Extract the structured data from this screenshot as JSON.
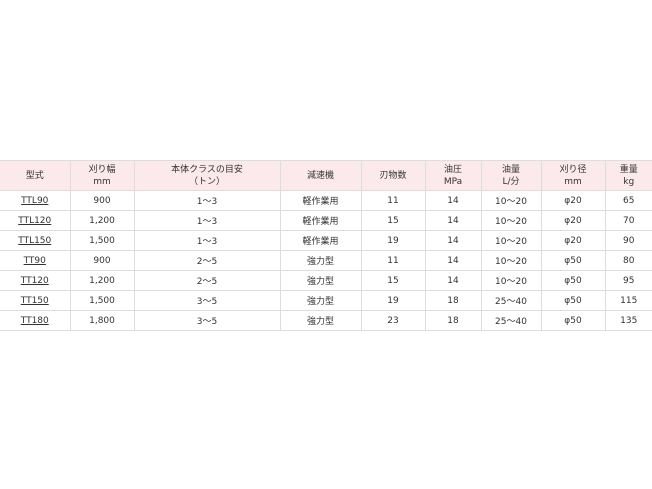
{
  "table": {
    "headers": [
      {
        "line1": "型式",
        "line2": ""
      },
      {
        "line1": "刈り幅",
        "line2": "mm"
      },
      {
        "line1": "本体クラスの目安",
        "line2": "（トン）"
      },
      {
        "line1": "減速機",
        "line2": ""
      },
      {
        "line1": "刃物数",
        "line2": ""
      },
      {
        "line1": "油圧",
        "line2": "MPa"
      },
      {
        "line1": "油量",
        "line2": "L/分"
      },
      {
        "line1": "刈り径",
        "line2": "mm"
      },
      {
        "line1": "重量",
        "line2": "kg"
      }
    ],
    "rows": [
      {
        "model": "TTL90",
        "width": "900",
        "class": "1〜3",
        "reducer": "軽作業用",
        "blades": "11",
        "pressure": "14",
        "flow": "10〜20",
        "diameter": "φ20",
        "weight": "65"
      },
      {
        "model": "TTL120",
        "width": "1,200",
        "class": "1〜3",
        "reducer": "軽作業用",
        "blades": "15",
        "pressure": "14",
        "flow": "10〜20",
        "diameter": "φ20",
        "weight": "70"
      },
      {
        "model": "TTL150",
        "width": "1,500",
        "class": "1〜3",
        "reducer": "軽作業用",
        "blades": "19",
        "pressure": "14",
        "flow": "10〜20",
        "diameter": "φ20",
        "weight": "90"
      },
      {
        "model": "TT90",
        "width": "900",
        "class": "2〜5",
        "reducer": "強力型",
        "blades": "11",
        "pressure": "14",
        "flow": "10〜20",
        "diameter": "φ50",
        "weight": "80"
      },
      {
        "model": "TT120",
        "width": "1,200",
        "class": "2〜5",
        "reducer": "強力型",
        "blades": "15",
        "pressure": "14",
        "flow": "10〜20",
        "diameter": "φ50",
        "weight": "95"
      },
      {
        "model": "TT150",
        "width": "1,500",
        "class": "3〜5",
        "reducer": "強力型",
        "blades": "19",
        "pressure": "18",
        "flow": "25〜40",
        "diameter": "φ50",
        "weight": "115"
      },
      {
        "model": "TT180",
        "width": "1,800",
        "class": "3〜5",
        "reducer": "強力型",
        "blades": "23",
        "pressure": "18",
        "flow": "25〜40",
        "diameter": "φ50",
        "weight": "135"
      }
    ]
  }
}
